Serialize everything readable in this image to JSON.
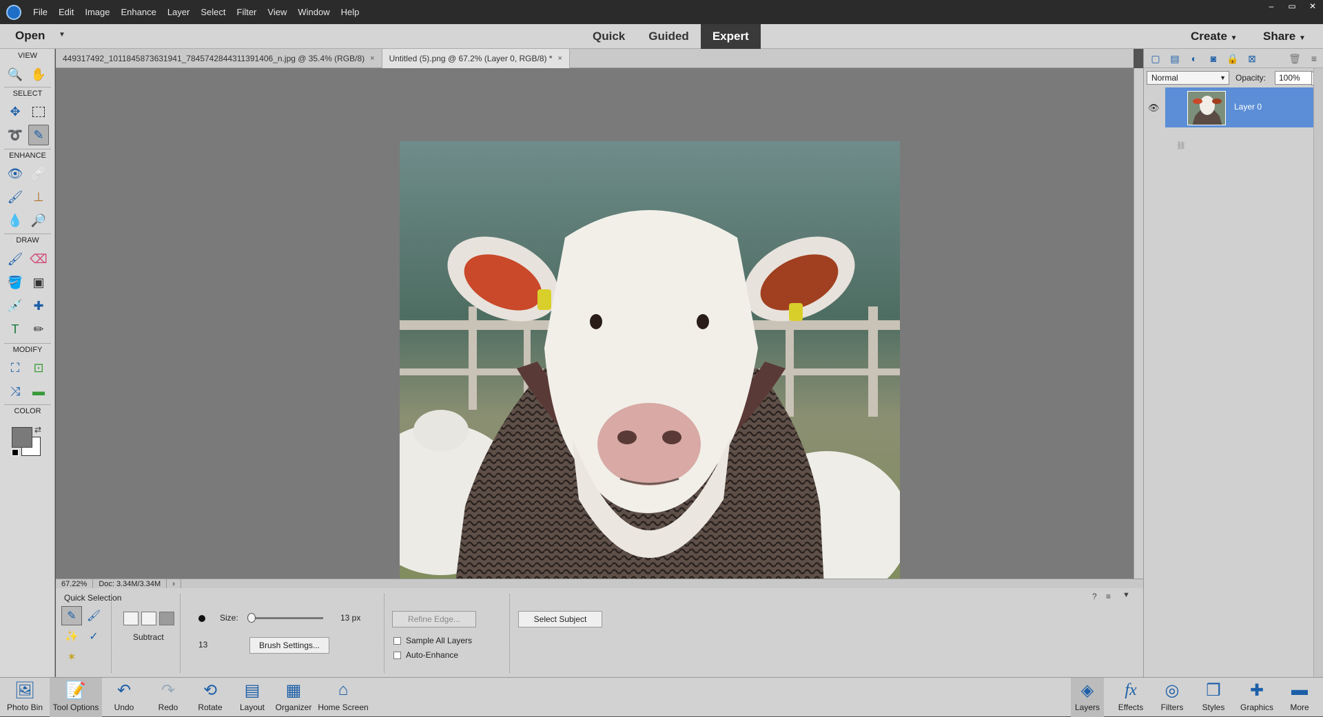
{
  "menubar": {
    "items": [
      "File",
      "Edit",
      "Image",
      "Enhance",
      "Layer",
      "Select",
      "Filter",
      "View",
      "Window",
      "Help"
    ],
    "window_controls": [
      "–",
      "▭",
      "✕"
    ]
  },
  "modebar": {
    "open": "Open",
    "modes": [
      "Quick",
      "Guided",
      "Expert"
    ],
    "active_mode": "Expert",
    "create": "Create",
    "share": "Share"
  },
  "toolbox": {
    "sections": [
      "VIEW",
      "SELECT",
      "ENHANCE",
      "DRAW",
      "MODIFY",
      "COLOR"
    ]
  },
  "doctabs": [
    {
      "label": "449317492_1011845873631941_7845742844311391406_n.jpg @ 35.4% (RGB/8)",
      "close": "×"
    },
    {
      "label": "Untitled (5).png @ 67.2% (Layer 0, RGB/8) *",
      "close": "×"
    }
  ],
  "statusbar": {
    "zoom": "67.22%",
    "doc": "Doc: 3.34M/3.34M"
  },
  "tool_options": {
    "title": "Quick Selection",
    "mode_label": "Subtract",
    "size_label": "Size:",
    "size_value": "13 px",
    "brush_size_number": "13",
    "brush_settings": "Brush Settings...",
    "refine_edge": "Refine Edge...",
    "sample_all_layers": "Sample All Layers",
    "auto_enhance": "Auto-Enhance",
    "select_subject": "Select Subject",
    "slider_fraction": 0.02
  },
  "layers_panel": {
    "blend_mode": "Normal",
    "opacity_label": "Opacity:",
    "opacity_value": "100%",
    "layer_name": "Layer 0"
  },
  "taskbar": {
    "left": [
      "Photo Bin",
      "Tool Options",
      "Undo",
      "Redo",
      "Rotate",
      "Layout",
      "Organizer",
      "Home Screen"
    ],
    "right": [
      "Layers",
      "Effects",
      "Filters",
      "Styles",
      "Graphics",
      "More"
    ]
  }
}
